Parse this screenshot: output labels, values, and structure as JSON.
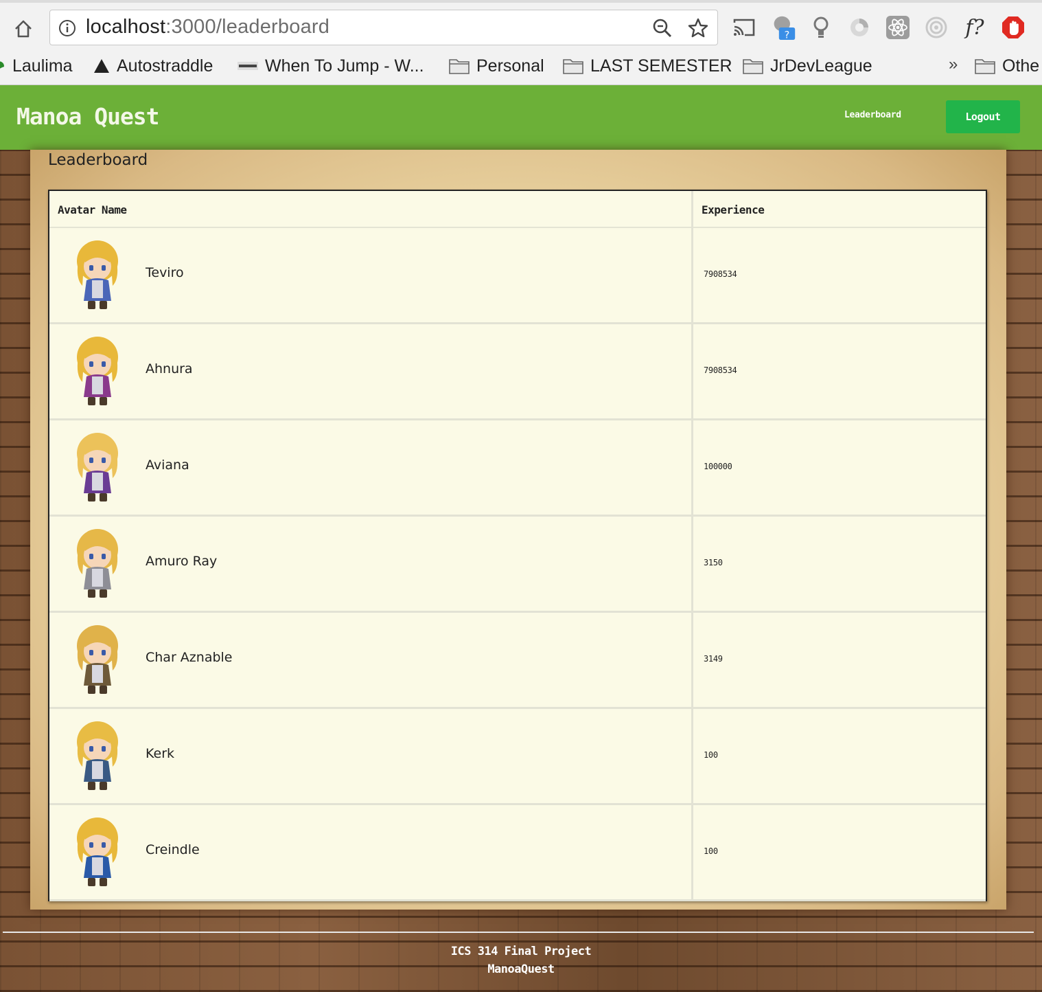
{
  "browser": {
    "url_host": "localhost",
    "url_rest": ":3000/leaderboard",
    "bookmarks": [
      {
        "label": "Laulima",
        "icon": "leaf-icon"
      },
      {
        "label": "Autostraddle",
        "icon": "triangle-icon"
      },
      {
        "label": "When To Jump - W...",
        "icon": "jump-icon"
      },
      {
        "label": "Personal",
        "icon": "folder-icon"
      },
      {
        "label": "LAST SEMESTER",
        "icon": "folder-icon"
      },
      {
        "label": "JrDevLeague",
        "icon": "folder-icon"
      },
      {
        "label": "Othe",
        "icon": "folder-icon"
      }
    ],
    "overflow_chevron": "»",
    "extensions": [
      "cast-icon",
      "help-extension-icon",
      "lightbulb-icon",
      "spinner-extension-icon",
      "react-devtools-icon",
      "target-extension-icon",
      "formula-extension-icon",
      "adblock-hand-icon"
    ],
    "formula_glyph": "f?"
  },
  "navbar": {
    "brand": "Manoa Quest",
    "leaderboard_link": "Leaderboard",
    "logout_label": "Logout"
  },
  "page": {
    "heading": "Leaderboard"
  },
  "table": {
    "headers": [
      "Avatar Name",
      "Experience"
    ],
    "rows": [
      {
        "name": "Teviro",
        "experience": "7908534",
        "hair": "#e8b83a",
        "outfit": "#4a66b8"
      },
      {
        "name": "Ahnura",
        "experience": "7908534",
        "hair": "#e8b83a",
        "outfit": "#8a3a8c"
      },
      {
        "name": "Aviana",
        "experience": "100000",
        "hair": "#ecc25a",
        "outfit": "#6a3c94"
      },
      {
        "name": "Amuro Ray",
        "experience": "3150",
        "hair": "#e6b848",
        "outfit": "#8e8e96"
      },
      {
        "name": "Char Aznable",
        "experience": "3149",
        "hair": "#e0b24a",
        "outfit": "#6e5a3a"
      },
      {
        "name": "Kerk",
        "experience": "100",
        "hair": "#e8bc44",
        "outfit": "#3a5a84"
      },
      {
        "name": "Creindle",
        "experience": "100",
        "hair": "#e8b83a",
        "outfit": "#2a5aa8"
      }
    ]
  },
  "footer": {
    "line1": "ICS 314 Final Project",
    "line2": "ManoaQuest"
  },
  "colors": {
    "navbar_green": "#6cb038",
    "logout_green": "#22b44a",
    "table_bg": "#fbfae6"
  }
}
